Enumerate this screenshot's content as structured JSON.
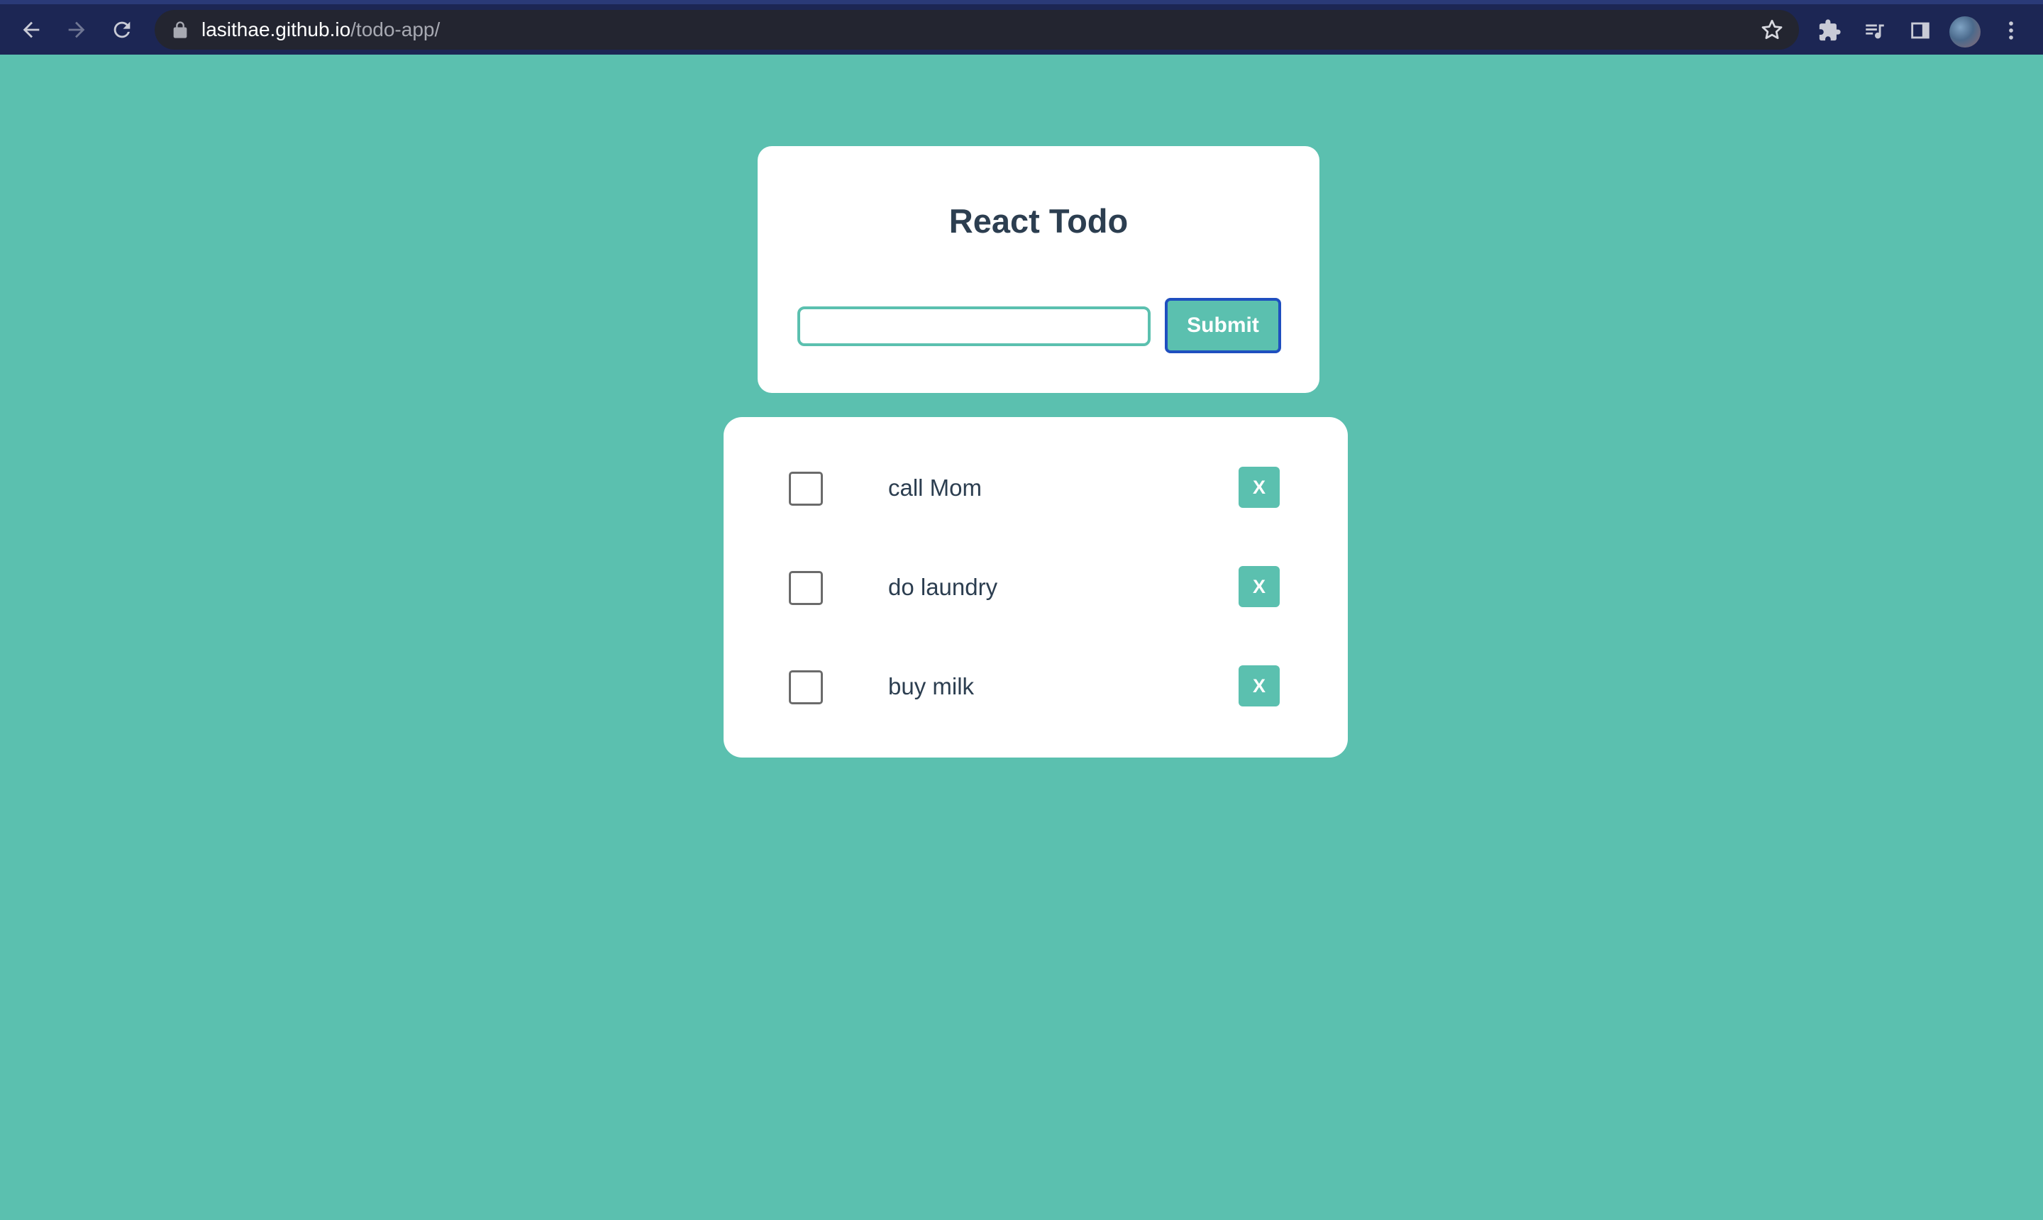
{
  "browser": {
    "url_host": "lasithae.github.io",
    "url_path": "/todo-app/",
    "colors": {
      "chrome": "#1c2654",
      "omnibox": "#232530"
    },
    "icons": [
      "back-arrow-icon",
      "forward-arrow-icon",
      "reload-icon",
      "lock-icon",
      "star-icon",
      "extensions-puzzle-icon",
      "media-queue-icon",
      "side-panel-icon",
      "profile-avatar",
      "kebab-menu-icon"
    ]
  },
  "app": {
    "title": "React Todo",
    "input": {
      "value": "",
      "placeholder": ""
    },
    "submit_label": "Submit",
    "colors": {
      "background": "#5bc0af",
      "accent": "#5bc0af",
      "text": "#2c3e50",
      "submit_border": "#1f4fbf"
    },
    "todos": [
      {
        "text": "call Mom",
        "checked": false,
        "delete_label": "X"
      },
      {
        "text": "do laundry",
        "checked": false,
        "delete_label": "X"
      },
      {
        "text": "buy milk",
        "checked": false,
        "delete_label": "X"
      }
    ]
  }
}
